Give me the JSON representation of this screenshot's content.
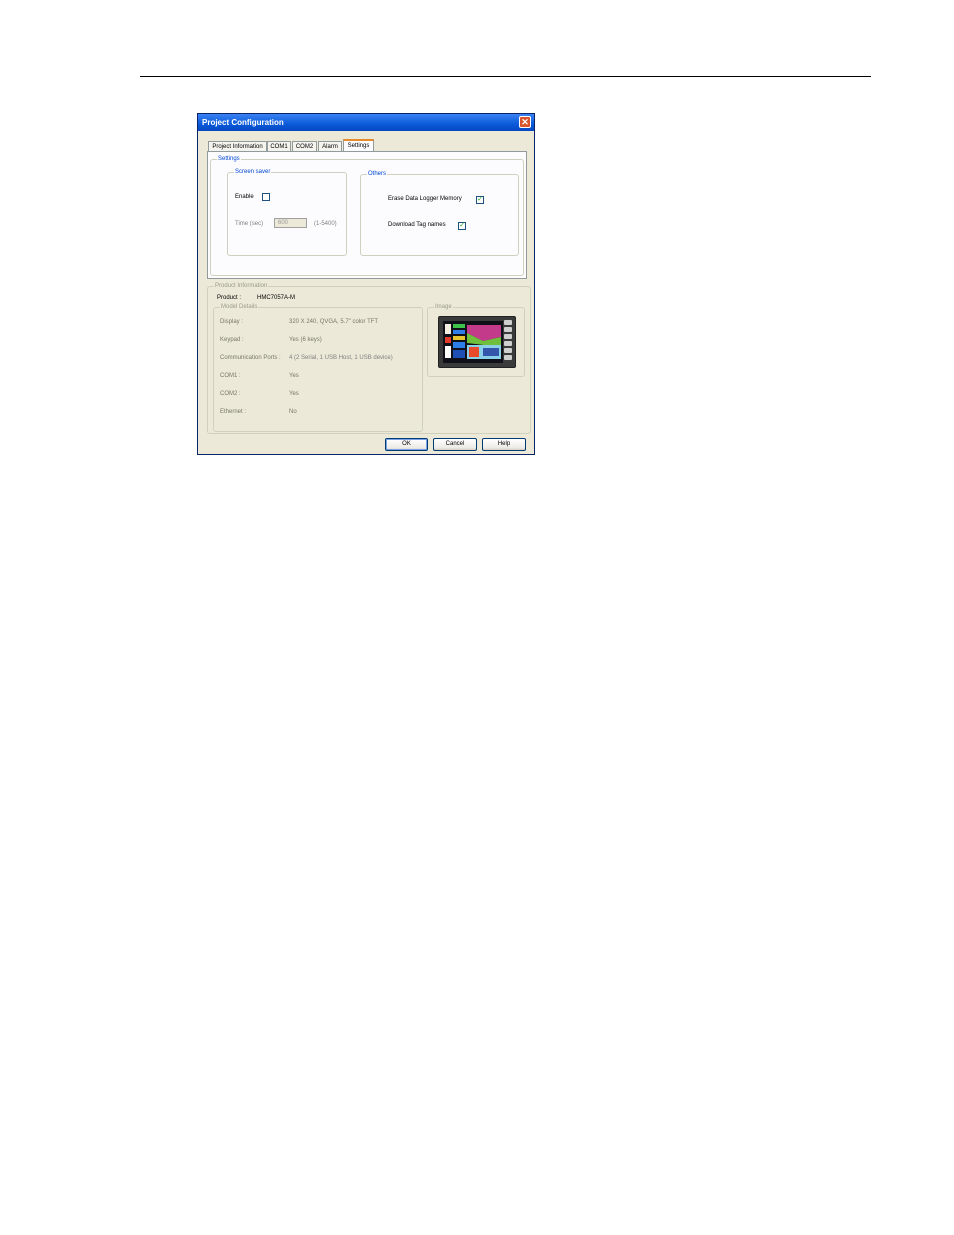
{
  "dialog": {
    "title": "Project Configuration",
    "close_symbol": "✕"
  },
  "tabs": [
    {
      "label": "Project Information"
    },
    {
      "label": "COM1"
    },
    {
      "label": "COM2"
    },
    {
      "label": "Alarm"
    },
    {
      "label": "Settings"
    }
  ],
  "active_tab": "Settings",
  "settings": {
    "legend": "Settings",
    "screen_saver": {
      "legend": "Screen saver",
      "enable_label": "Enable",
      "enable_checked": false,
      "time_label": "Time (sec)",
      "time_value": "600",
      "time_range": "(1-5400)"
    },
    "others": {
      "legend": "Others",
      "erase_label": "Erase Data Logger Memory",
      "erase_checked": true,
      "download_label": "Download Tag names",
      "download_checked": true
    }
  },
  "product_info": {
    "legend": "Product Information",
    "product_label": "Product :",
    "product_value": "HMC7057A-M",
    "model_details_legend": "Model Details",
    "image_legend": "Image",
    "details": [
      {
        "label": "Display :",
        "value": "320 X 240, QVGA, 5.7\" color TFT"
      },
      {
        "label": "Keypad :",
        "value": "Yes (6 keys)"
      },
      {
        "label": "Communication Ports :",
        "value": "4 (2 Serial, 1 USB Host, 1 USB device)"
      },
      {
        "label": "COM1 :",
        "value": "Yes"
      },
      {
        "label": "COM2 :",
        "value": "Yes"
      },
      {
        "label": "Ethernet :",
        "value": "No"
      }
    ]
  },
  "buttons": {
    "ok": "OK",
    "cancel": "Cancel",
    "help": "Help"
  },
  "colors": {
    "title_bar": "#0a5ad8",
    "dialog_bg": "#ece9d8",
    "legend_blue": "#0046d5",
    "check": "#21a121"
  },
  "check_symbol": "✓"
}
